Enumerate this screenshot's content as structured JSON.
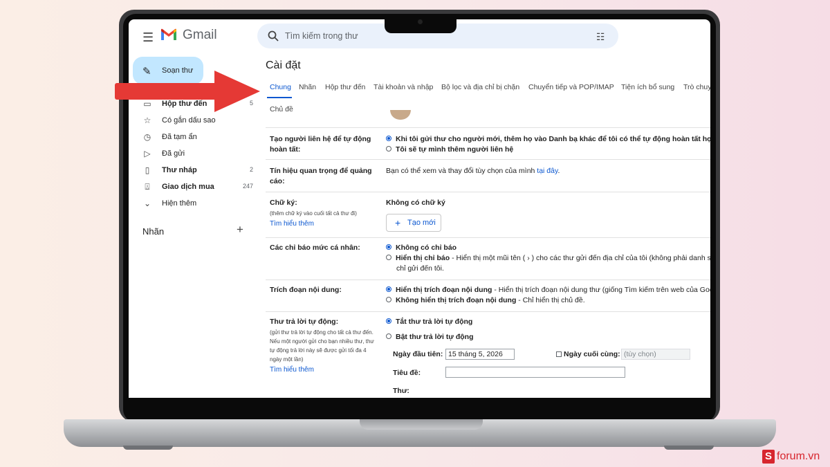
{
  "app": {
    "name": "Gmail"
  },
  "search": {
    "placeholder": "Tìm kiếm trong thư"
  },
  "sidebar": {
    "compose_label": "Soạn thư",
    "items": [
      {
        "label": "Hộp thư đến",
        "count": "5",
        "icon": "inbox-icon"
      },
      {
        "label": "Có gắn dấu sao",
        "count": "",
        "icon": "star-icon"
      },
      {
        "label": "Đã tạm ẩn",
        "count": "",
        "icon": "clock-icon"
      },
      {
        "label": "Đã gửi",
        "count": "",
        "icon": "send-icon"
      },
      {
        "label": "Thư nháp",
        "count": "2",
        "icon": "draft-icon"
      },
      {
        "label": "Giao dịch mua",
        "count": "247",
        "icon": "shopping-bag-icon"
      },
      {
        "label": "Hiện thêm",
        "count": "",
        "icon": "chevron-down-icon"
      }
    ],
    "labels_heading": "Nhãn"
  },
  "settings": {
    "title": "Cài đặt",
    "tabs": [
      "Chung",
      "Nhãn",
      "Hộp thư đến",
      "Tài khoản và nhập",
      "Bộ lọc và địa chỉ bị chặn",
      "Chuyển tiếp và POP/IMAP",
      "Tiện ích bổ sung",
      "Trò chuy"
    ],
    "tab_row2": "Chủ đề",
    "active_tab": "Chung",
    "rows": {
      "contacts": {
        "label": "Tạo người liên hệ để tự động hoàn tất:",
        "opt1": "Khi tôi gửi thư cho người mới, thêm họ vào Danh bạ khác để tôi có thể tự động hoàn tất họ lầ",
        "opt2": "Tôi sẽ tự mình thêm người liên hệ"
      },
      "ads": {
        "label": "Tín hiệu quan trọng để quảng cáo:",
        "text": "Bạn có thể xem và thay đổi tùy chọn của mình",
        "link": "tại đây",
        "suffix": "."
      },
      "signature": {
        "label": "Chữ ký:",
        "sub": "(thêm chữ ký vào cuối tất cả thư đi)",
        "learn": "Tìm hiểu thêm",
        "none": "Không có chữ ký",
        "create_button": "Tạo mới"
      },
      "indicators": {
        "label": "Các chỉ báo mức cá nhân:",
        "opt1": "Không có chỉ báo",
        "opt2_bold": "Hiển thị chỉ báo",
        "opt2_rest": " - Hiển thị một mũi tên ( › ) cho các thư gửi đến địa chỉ của tôi (không phải danh sá",
        "opt2_line2": "chỉ gửi đến tôi."
      },
      "snippets": {
        "label": "Trích đoạn nội dung:",
        "opt1_bold": "Hiển thị trích đoạn nội dung",
        "opt1_rest": " - Hiển thị trích đoạn nội dung thư (giống Tìm kiếm trên web của Goog",
        "opt2_bold": "Không hiển thị trích đoạn nội dung",
        "opt2_rest": " - Chỉ hiển thị chủ đề."
      },
      "vacation": {
        "label": "Thư trả lời tự động:",
        "sub1": "(gửi thư trả lời tự động cho tất cả thư đến.",
        "sub2": "Nếu một người gửi cho bạn nhiều thư, thư",
        "sub3": "tự động trả lời này sẽ được gửi tối đa 4",
        "sub4": "ngày một lần)",
        "learn": "Tìm hiểu thêm",
        "off": "Tắt thư trả lời tự động",
        "on": "Bật thư trả lời tự động",
        "first_day_label": "Ngày đầu tiên:",
        "first_day_value": "15 tháng 5, 2026",
        "last_day_label": "Ngày cuối cùng:",
        "last_day_placeholder": "(tùy chọn)",
        "subject_label": "Tiêu đề:",
        "body_label": "Thư:"
      }
    }
  },
  "watermark": {
    "box": "S",
    "text": "forum.vn"
  },
  "colors": {
    "accent": "#0b57d0",
    "compose_bg": "#c2e7ff",
    "arrow": "#e53935",
    "brand": "#d7262e"
  }
}
